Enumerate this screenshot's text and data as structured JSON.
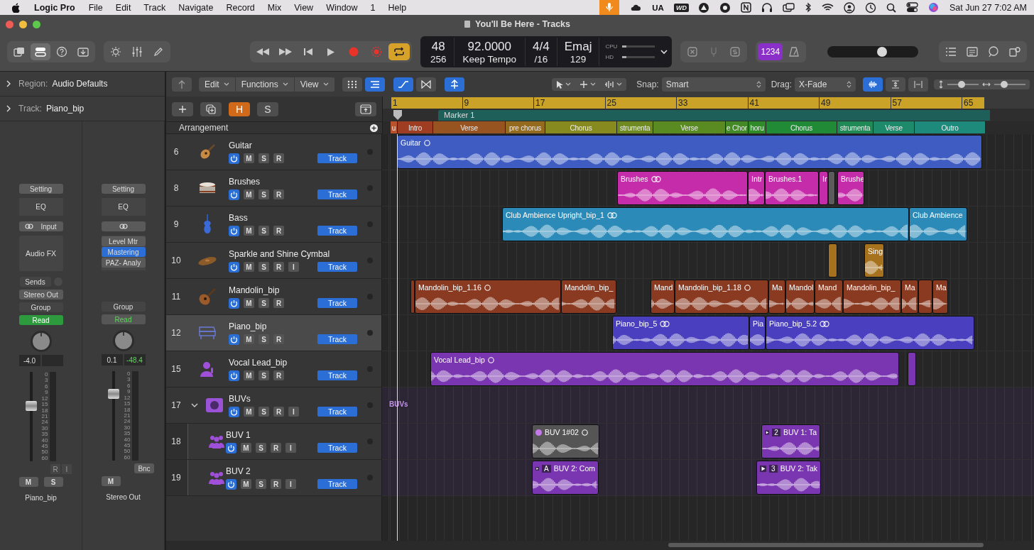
{
  "menu_bar": {
    "app": "Logic Pro",
    "items": [
      "File",
      "Edit",
      "Track",
      "Navigate",
      "Record",
      "Mix",
      "View",
      "Window",
      "1",
      "Help"
    ],
    "status_texts": [
      "UA",
      "WD"
    ],
    "clock": "Sat Jun 27  7:02 AM"
  },
  "window": {
    "title": "You'll Be Here - Tracks"
  },
  "transport": {
    "cycle_on": true
  },
  "lcd": {
    "bar": "48",
    "beat": "256",
    "tempo": "92.0000",
    "tempo_mode": "Keep Tempo",
    "signature": "4/4",
    "division": "/16",
    "key": "Emaj",
    "key_number": "129",
    "cpu_label": "CPU",
    "hd_label": "HD"
  },
  "count_in": {
    "label": "1234",
    "on": true
  },
  "master_volume": {
    "level": 0.62
  },
  "inspector": {
    "region": {
      "label": "Region:",
      "value": "Audio Defaults"
    },
    "track": {
      "label": "Track:",
      "value": "Piano_bip"
    },
    "strips": [
      {
        "setting": "Setting",
        "eq": "EQ",
        "input": "Input",
        "audio_fx": "Audio FX",
        "sends": "Sends",
        "output": "Stereo Out",
        "group": "Group",
        "automation": "Read",
        "automation_on": true,
        "volume": "-4.0",
        "level": 0.63,
        "scale": [
          "0",
          "3",
          "6",
          "9",
          "12",
          "15",
          "18",
          "21",
          "24",
          "30",
          "35",
          "40",
          "45",
          "50",
          "60"
        ],
        "small_buttons": [
          "R",
          "I"
        ],
        "buttons": [
          "M",
          "S"
        ],
        "name": "Piano_bip"
      },
      {
        "setting": "Setting",
        "eq": "EQ",
        "plugins": [
          {
            "name": "Level Mtr",
            "selected": false
          },
          {
            "name": "Mastering",
            "selected": true
          },
          {
            "name": "PAZ- Analy",
            "selected": false
          }
        ],
        "group": "Group",
        "automation": "Read",
        "automation_on": false,
        "volume": "0.1",
        "peak": "-48.4",
        "level": 0.78,
        "scale": [
          "0",
          "3",
          "6",
          "9",
          "12",
          "15",
          "18",
          "21",
          "24",
          "30",
          "35",
          "40",
          "45",
          "50",
          "60"
        ],
        "bounce": "Bnc",
        "buttons": [
          "M"
        ],
        "name": "Stereo Out"
      }
    ]
  },
  "editor_toolbar": {
    "menus": [
      "Edit",
      "Functions",
      "View"
    ],
    "snap_label": "Snap:",
    "snap": "Smart",
    "drag_label": "Drag:",
    "drag": "X-Fade",
    "vertical_zoom": {
      "level": 0.45
    },
    "horizontal_zoom": {
      "level": 0.25
    }
  },
  "track_buttons": {
    "hide": "H",
    "hide_on": true,
    "solo": "S"
  },
  "arrangement": {
    "label": "Arrangement",
    "ruler": [
      "1",
      "9",
      "17",
      "25",
      "33",
      "41",
      "49",
      "57",
      "65"
    ],
    "marker": "Marker 1",
    "sections": [
      {
        "name": "u",
        "color": "#b8532c"
      },
      {
        "name": "Intro",
        "color": "#9e3d22"
      },
      {
        "name": "Verse",
        "color": "#985420"
      },
      {
        "name": "pre chorus",
        "color": "#946a1e"
      },
      {
        "name": "Chorus",
        "color": "#878a1e"
      },
      {
        "name": "strumenta",
        "color": "#6e8a20"
      },
      {
        "name": "Verse",
        "color": "#5a8a22"
      },
      {
        "name": "e Chor",
        "color": "#438a26"
      },
      {
        "name": "horu",
        "color": "#308a2a"
      },
      {
        "name": "Chorus",
        "color": "#218a36"
      },
      {
        "name": "strumenta",
        "color": "#1f8a55"
      },
      {
        "name": "Verse",
        "color": "#1e8a6c"
      },
      {
        "name": "Outro",
        "color": "#1e8a7c"
      }
    ]
  },
  "tracks": [
    {
      "number": "6",
      "name": "Guitar",
      "color": "#3e5cc2",
      "selected": false,
      "buttons": [
        "M",
        "S",
        "R"
      ],
      "tag": "Track",
      "regions": [
        {
          "kind": "audio",
          "name": "Guitar"
        }
      ]
    },
    {
      "number": "8",
      "name": "Brushes",
      "color": "#c42ca9",
      "selected": false,
      "buttons": [
        "M",
        "S",
        "R"
      ],
      "tag": "Track",
      "regions": [
        {
          "kind": "audio",
          "name": "Brushes"
        },
        {
          "kind": "audio",
          "name": "Intr"
        },
        {
          "kind": "audio",
          "name": "Brushes.1"
        },
        {
          "kind": "audio",
          "name": "In"
        },
        {
          "kind": "audio",
          "color": "#5c5c5c"
        },
        {
          "kind": "audio",
          "name": "Brushe"
        }
      ]
    },
    {
      "number": "9",
      "name": "Bass",
      "color": "#2b8ab8",
      "selected": false,
      "buttons": [
        "M",
        "S",
        "R"
      ],
      "tag": "Track",
      "regions": [
        {
          "kind": "audio",
          "name": "Club Ambience Upright_bip_1"
        },
        {
          "kind": "audio",
          "name": "Club Ambience"
        }
      ]
    },
    {
      "number": "10",
      "name": "Sparkle and Shine Cymbal",
      "color": "#a6721e",
      "selected": false,
      "buttons": [
        "M",
        "S",
        "R",
        "I"
      ],
      "tag": "Track",
      "regions": [
        {
          "kind": "audio"
        },
        {
          "kind": "audio",
          "name": "Sing"
        }
      ]
    },
    {
      "number": "11",
      "name": "Mandolin_bip",
      "color": "#8a3a20",
      "selected": false,
      "buttons": [
        "M",
        "S",
        "R"
      ],
      "tag": "Track",
      "regions": [
        {
          "kind": "audio"
        },
        {
          "kind": "audio",
          "name": "Mandolin_bip_1.16"
        },
        {
          "kind": "audio",
          "name": "Mandolin_bip_"
        },
        {
          "kind": "audio",
          "name": "Mand"
        },
        {
          "kind": "audio",
          "name": "Mandolin_bip_1.18"
        },
        {
          "kind": "audio",
          "name": "Ma"
        },
        {
          "kind": "audio",
          "name": "Mandol"
        },
        {
          "kind": "audio",
          "name": "Mand"
        },
        {
          "kind": "audio",
          "name": "Mandolin_bip_"
        },
        {
          "kind": "audio",
          "name": "Ma"
        },
        {
          "kind": "audio"
        },
        {
          "kind": "audio",
          "name": "Ma"
        }
      ]
    },
    {
      "number": "12",
      "name": "Piano_bip",
      "color": "#4a3fbe",
      "selected": true,
      "buttons": [
        "M",
        "S",
        "R"
      ],
      "tag": "Track",
      "regions": [
        {
          "kind": "audio",
          "name": "Piano_bip_5"
        },
        {
          "kind": "audio",
          "name": "Pia"
        },
        {
          "kind": "audio",
          "name": "Piano_bip_5.2"
        }
      ]
    },
    {
      "number": "15",
      "name": "Vocal Lead_bip",
      "color": "#7a35b0",
      "selected": false,
      "buttons": [
        "M",
        "S",
        "R"
      ],
      "tag": "Track",
      "regions": [
        {
          "kind": "audio",
          "name": "Vocal Lead_bip"
        },
        {
          "kind": "audio"
        }
      ]
    },
    {
      "number": "17",
      "name": "BUVs",
      "color": "#9a52d6",
      "selected": false,
      "expanded": true,
      "lane_label": "BUVs",
      "buttons": [
        "M",
        "S",
        "R",
        "I"
      ],
      "tag": "Track",
      "children": [
        {
          "number": "18",
          "name": "BUV 1",
          "color": "#7a35b0",
          "selected": false,
          "buttons": [
            "M",
            "S",
            "R",
            "I"
          ],
          "tag": "Track",
          "regions": [
            {
              "kind": "audio",
              "name": "BUV 1#02",
              "color": "#555555"
            },
            {
              "kind": "take",
              "name": "BUV 1: Ta",
              "take": "2"
            }
          ]
        },
        {
          "number": "19",
          "name": "BUV 2",
          "color": "#7a35b0",
          "selected": false,
          "buttons": [
            "M",
            "S",
            "R",
            "I"
          ],
          "tag": "Track",
          "regions": [
            {
              "kind": "take",
              "name": "BUV 2: Com",
              "take": "A"
            },
            {
              "kind": "take",
              "name": "BUV 2: Tak",
              "take": "3"
            }
          ]
        }
      ]
    }
  ]
}
